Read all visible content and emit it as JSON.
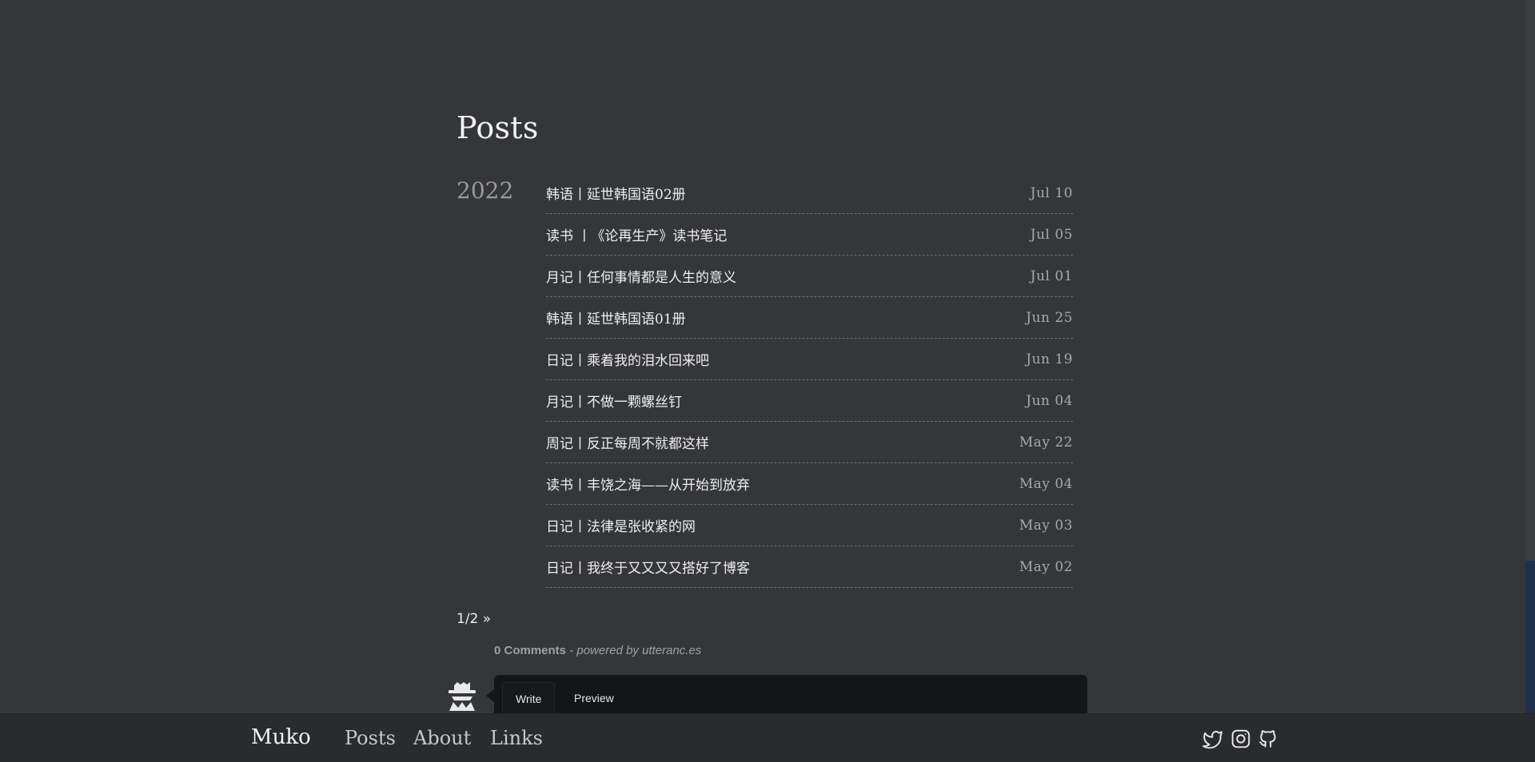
{
  "page": {
    "title": "Posts"
  },
  "archive": {
    "year": "2022",
    "posts": [
      {
        "title": "韩语丨延世韩国语02册",
        "date": "Jul 10"
      },
      {
        "title": "读书 丨《论再生产》读书笔记",
        "date": "Jul 05"
      },
      {
        "title": "月记丨任何事情都是人生的意义",
        "date": "Jul 01"
      },
      {
        "title": "韩语丨延世韩国语01册",
        "date": "Jun 25"
      },
      {
        "title": "日记丨乘着我的泪水回来吧",
        "date": "Jun 19"
      },
      {
        "title": "月记丨不做一颗螺丝钉",
        "date": "Jun 04"
      },
      {
        "title": "周记丨反正每周不就都这样",
        "date": "May 22"
      },
      {
        "title": "读书丨丰饶之海——从开始到放弃",
        "date": "May 04"
      },
      {
        "title": "日记丨法律是张收紧的网",
        "date": "May 03"
      },
      {
        "title": "日记丨我终于又又又又搭好了博客",
        "date": "May 02"
      }
    ]
  },
  "pagination": {
    "label": "1/2 »"
  },
  "comments": {
    "count_label": "0 Comments",
    "powered_by": "- powered by utteranc.es",
    "tabs": {
      "write": "Write",
      "preview": "Preview"
    }
  },
  "footer": {
    "brand": "Muko",
    "nav": {
      "posts": "Posts",
      "about": "About",
      "links": "Links"
    },
    "social_icons": [
      "twitter-icon",
      "instagram-icon",
      "github-icon"
    ]
  },
  "colors": {
    "background": "#35363a",
    "footer": "#2a2b2e",
    "comment_box": "#141519"
  }
}
